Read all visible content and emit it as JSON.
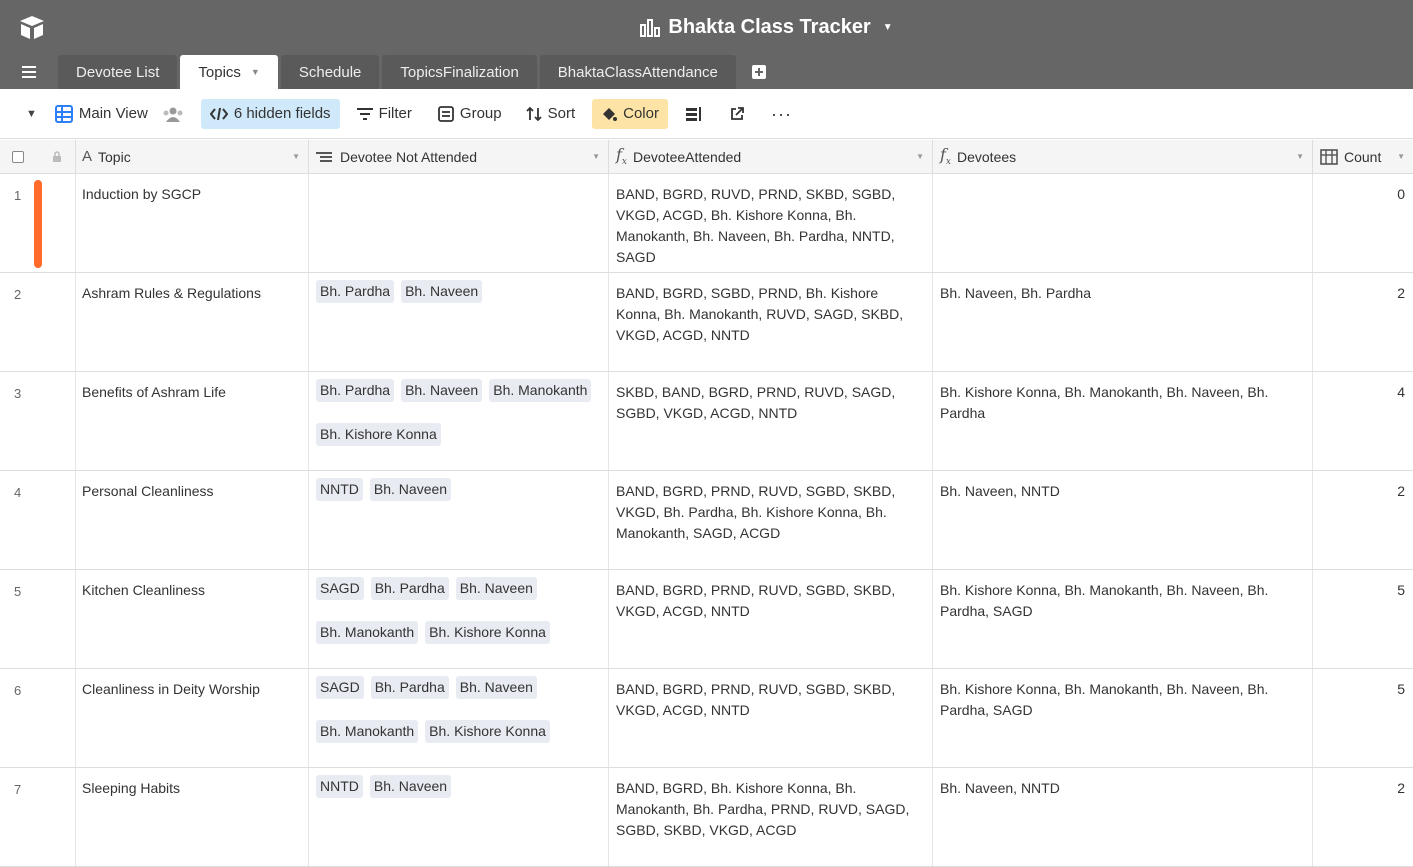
{
  "app": {
    "title": "Bhakta Class Tracker"
  },
  "tabs": [
    {
      "label": "Devotee List"
    },
    {
      "label": "Topics"
    },
    {
      "label": "Schedule"
    },
    {
      "label": "TopicsFinalization"
    },
    {
      "label": "BhaktaClassAttendance"
    }
  ],
  "toolbar": {
    "view_name": "Main View",
    "hidden_fields": "6 hidden fields",
    "filter": "Filter",
    "group": "Group",
    "sort": "Sort",
    "color": "Color"
  },
  "colors": {
    "accent": "#ff6b2b",
    "topbar": "#666666",
    "hidden_bg": "#cfe9fa",
    "color_bg": "#fde4a6"
  },
  "columns": {
    "topic": "Topic",
    "not_attended": "Devotee Not Attended",
    "attended": "DevoteeAttended",
    "devotees": "Devotees",
    "count": "Count"
  },
  "rows": [
    {
      "num": "1",
      "topic": "Induction by SGCP",
      "not_attended": [],
      "attended": "BAND, BGRD, RUVD, PRND, SKBD, SGBD, VKGD, ACGD, Bh. Kishore Konna, Bh. Manokanth, Bh. Naveen, Bh. Pardha, NNTD, SAGD",
      "devotees": "",
      "count": "0"
    },
    {
      "num": "2",
      "topic": "Ashram Rules & Regulations",
      "not_attended": [
        "Bh. Pardha",
        "Bh. Naveen"
      ],
      "attended": "BAND, BGRD, SGBD, PRND, Bh. Kishore Konna, Bh. Manokanth, RUVD, SAGD, SKBD, VKGD, ACGD, NNTD",
      "devotees": "Bh. Naveen, Bh. Pardha",
      "count": "2"
    },
    {
      "num": "3",
      "topic": "Benefits of Ashram Life",
      "not_attended": [
        "Bh. Pardha",
        "Bh. Naveen",
        "Bh. Manokanth",
        "Bh. Kishore Konna"
      ],
      "attended": "SKBD, BAND, BGRD, PRND, RUVD, SAGD, SGBD, VKGD, ACGD, NNTD",
      "devotees": "Bh. Kishore Konna, Bh. Manokanth, Bh. Naveen, Bh. Pardha",
      "count": "4"
    },
    {
      "num": "4",
      "topic": "Personal Cleanliness",
      "not_attended": [
        "NNTD",
        "Bh. Naveen"
      ],
      "attended": "BAND, BGRD, PRND, RUVD, SGBD, SKBD, VKGD, Bh. Pardha, Bh. Kishore Konna, Bh. Manokanth, SAGD, ACGD",
      "devotees": "Bh. Naveen, NNTD",
      "count": "2"
    },
    {
      "num": "5",
      "topic": "Kitchen Cleanliness",
      "not_attended": [
        "SAGD",
        "Bh. Pardha",
        "Bh. Naveen",
        "Bh. Manokanth",
        "Bh. Kishore Konna"
      ],
      "attended": "BAND, BGRD, PRND, RUVD, SGBD, SKBD, VKGD, ACGD, NNTD",
      "devotees": "Bh. Kishore Konna, Bh. Manokanth, Bh. Naveen, Bh. Pardha, SAGD",
      "count": "5"
    },
    {
      "num": "6",
      "topic": "Cleanliness in Deity Worship",
      "not_attended": [
        "SAGD",
        "Bh. Pardha",
        "Bh. Naveen",
        "Bh. Manokanth",
        "Bh. Kishore Konna"
      ],
      "attended": "BAND, BGRD, PRND, RUVD, SGBD, SKBD, VKGD, ACGD, NNTD",
      "devotees": "Bh. Kishore Konna, Bh. Manokanth, Bh. Naveen, Bh. Pardha, SAGD",
      "count": "5"
    },
    {
      "num": "7",
      "topic": "Sleeping Habits",
      "not_attended": [
        "NNTD",
        "Bh. Naveen"
      ],
      "attended": "BAND, BGRD, Bh. Kishore Konna, Bh. Manokanth, Bh. Pardha, PRND, RUVD, SAGD, SGBD, SKBD, VKGD, ACGD",
      "devotees": "Bh. Naveen, NNTD",
      "count": "2"
    }
  ]
}
